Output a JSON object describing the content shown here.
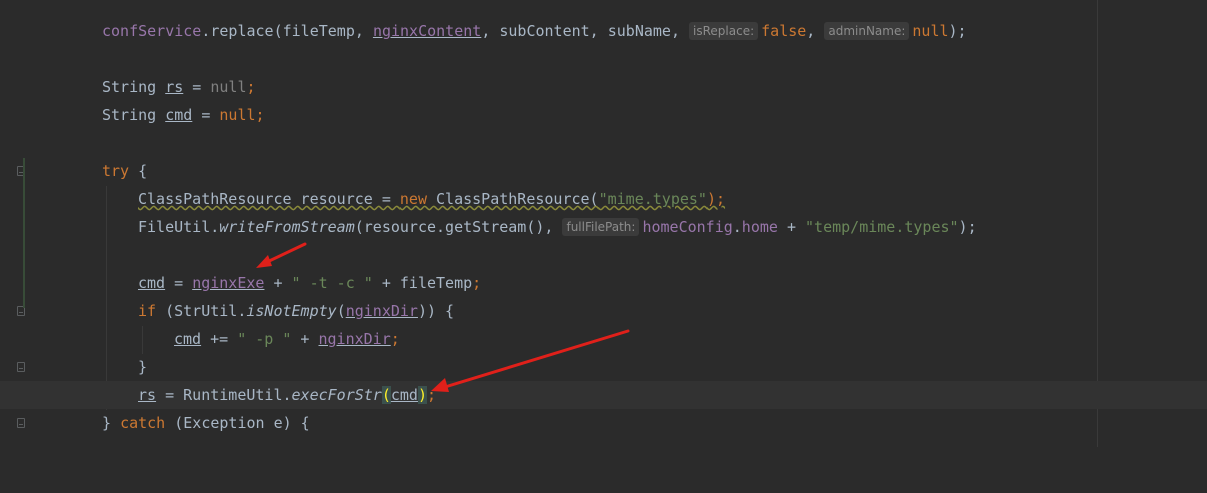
{
  "lines": {
    "l1": {
      "a": "confService",
      "b": ".replace(fileTemp, ",
      "c": "nginxContent",
      "d": ", subContent, subName, ",
      "hint1": "isReplace:",
      "e": "false",
      "f": ", ",
      "hint2": "adminName:",
      "g": "null",
      "h": ");"
    },
    "l2": {
      "a": "String ",
      "b": "rs",
      "c": " = ",
      "d": "null",
      "e": ";"
    },
    "l3": {
      "a": "String ",
      "b": "cmd",
      "c": " = ",
      "d": "null",
      "e": ";"
    },
    "l4": {
      "a": "try",
      "b": " {"
    },
    "l5": {
      "a": "ClassPathResource resource = ",
      "b": "new",
      "c": " ClassPathResource(",
      "d": "\"mime.types\"",
      "e": ");"
    },
    "l6": {
      "a": "FileUtil.",
      "b": "writeFromStream",
      "c": "(resource.getStream(), ",
      "hint": "fullFilePath:",
      "d": "homeConfig",
      "e": ".",
      "f": "home",
      "g": " + ",
      "h": "\"temp/mime.types\"",
      "i": ");"
    },
    "l7": {
      "a": "cmd",
      "b": " = ",
      "c": "nginxExe",
      "d": " + ",
      "e": "\" -t -c \"",
      "f": " + fileTemp",
      "g": ";"
    },
    "l8": {
      "a": "if",
      "b": " (StrUtil.",
      "c": "isNotEmpty",
      "d": "(",
      "e": "nginxDir",
      "f": ")) {"
    },
    "l9": {
      "a": "cmd",
      "b": " += ",
      "c": "\" -p \"",
      "d": " + ",
      "e": "nginxDir",
      "f": ";"
    },
    "l10": {
      "a": "}"
    },
    "l11": {
      "a": "rs",
      "b": " = RuntimeUtil.",
      "c": "execForStr",
      "d": "(",
      "e": "cmd",
      "f": ")",
      "g": ";"
    },
    "l12": {
      "a": "} ",
      "b": "catch",
      "c": " (Exception e) {"
    }
  },
  "annotations": {
    "arrow_color": "#e0201a"
  }
}
